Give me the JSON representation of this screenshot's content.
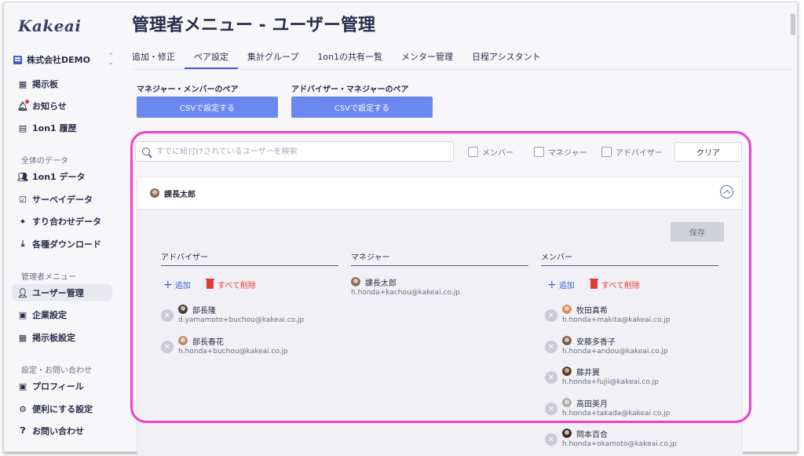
{
  "sidebar": {
    "logo": "Kakeai",
    "company": "株式会社DEMO",
    "items_top": [
      {
        "label": "掲示板",
        "icon": "board-icon"
      },
      {
        "label": "お知らせ",
        "icon": "bell-icon"
      },
      {
        "label": "1on1 履歴",
        "icon": "history-icon"
      }
    ],
    "section_all": "全体のデータ",
    "items_all": [
      {
        "label": "1on1 データ",
        "icon": "people-icon"
      },
      {
        "label": "サーベイデータ",
        "icon": "survey-icon"
      },
      {
        "label": "すり合わせデータ",
        "icon": "match-icon"
      },
      {
        "label": "各種ダウンロード",
        "icon": "download-icon"
      }
    ],
    "section_admin": "管理者メニュー",
    "items_admin": [
      {
        "label": "ユーザー管理",
        "icon": "user-manage-icon",
        "active": true
      },
      {
        "label": "企業設定",
        "icon": "company-icon"
      },
      {
        "label": "掲示板設定",
        "icon": "board-settings-icon"
      }
    ],
    "section_settings": "設定・お問い合わせ",
    "items_settings": [
      {
        "label": "プロフィール",
        "icon": "profile-icon"
      },
      {
        "label": "便利にする設定",
        "icon": "gear-icon"
      },
      {
        "label": "お問い合わせ",
        "icon": "help-icon"
      }
    ]
  },
  "main": {
    "title": "管理者メニュー - ユーザー管理",
    "tabs": [
      "追加・修正",
      "ペア設定",
      "集計グループ",
      "1on1の共有一覧",
      "メンター管理",
      "日程アシスタント"
    ],
    "active_tab": "ペア設定",
    "pair1_label": "マネジャー・メンバーのペア",
    "pair2_label": "アドバイザー・マネジャーのペア",
    "csv_button": "CSVで設定する",
    "search_placeholder": "すでに紐付けされているユーザーを検索",
    "filters": [
      "メンバー",
      "マネジャー",
      "アドバイザー"
    ],
    "clear_button": "クリア",
    "panel": {
      "name": "課長太郎",
      "save_button": "保存",
      "col_advisor": "アドバイザー",
      "col_manager": "マネジャー",
      "col_member": "メンバー",
      "add_label": "追加",
      "delete_all_label": "すべて削除",
      "advisors": [
        {
          "name": "部長隆",
          "email": "d.yamamoto+buchou@kakeai.co.jp"
        },
        {
          "name": "部長春花",
          "email": "h.honda+buchou@kakeai.co.jp"
        }
      ],
      "manager": {
        "name": "課長太郎",
        "email": "h.honda+kachou@kakeai.co.jp"
      },
      "members": [
        {
          "name": "牧田真希",
          "email": "h.honda+makita@kakeai.co.jp"
        },
        {
          "name": "安藤多香子",
          "email": "h.honda+andou@kakeai.co.jp"
        },
        {
          "name": "藤井翼",
          "email": "h.honda+fujii@kakeai.co.jp"
        },
        {
          "name": "高田美月",
          "email": "h.honda+takada@kakeai.co.jp"
        },
        {
          "name": "岡本百合",
          "email": "h.honda+okamoto@kakeai.co.jp"
        }
      ]
    }
  },
  "colors": {
    "accent": "#3f57d8",
    "button": "#6b87f0",
    "danger": "#e53935",
    "highlight": "#ee3fce"
  }
}
